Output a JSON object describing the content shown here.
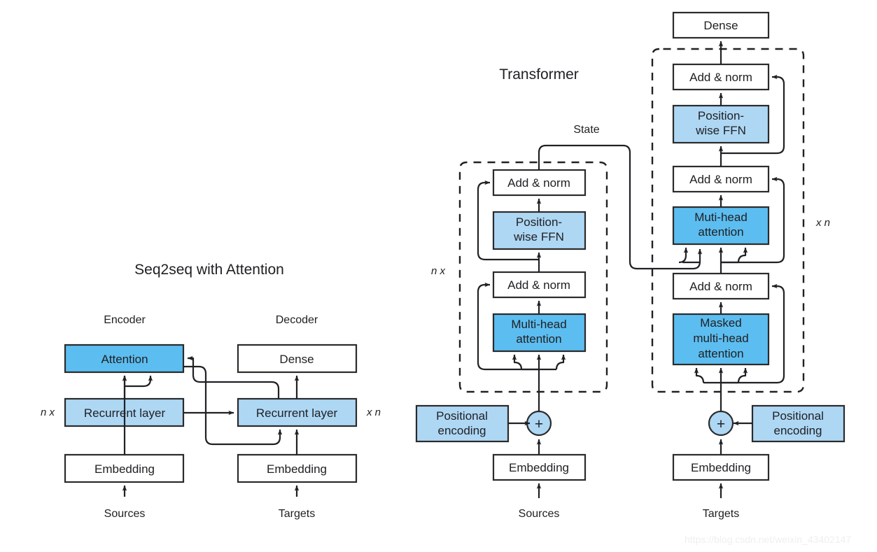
{
  "page": {
    "watermark": "https://blog.csdn.net/weixin_43402147"
  },
  "chart_data": {
    "type": "diagram",
    "title": "Seq2seq with Attention vs Transformer architecture comparison",
    "panels": [
      "Seq2seq with Attention",
      "Transformer"
    ]
  },
  "seq2seq": {
    "title": "Seq2seq with Attention",
    "encoder_label": "Encoder",
    "decoder_label": "Decoder",
    "repeat_left": "n x",
    "repeat_right": "x n",
    "encoder": {
      "attention": "Attention",
      "recurrent": "Recurrent layer",
      "embedding": "Embedding",
      "source": "Sources"
    },
    "decoder": {
      "dense": "Dense",
      "recurrent": "Recurrent layer",
      "embedding": "Embedding",
      "target": "Targets"
    }
  },
  "transformer": {
    "title": "Transformer",
    "state_label": "State",
    "repeat_encoder": "n x",
    "repeat_decoder": "x n",
    "encoder": {
      "add_norm_top": "Add & norm",
      "ffn": "Position-\nwise FFN",
      "ffn_line1": "Position-",
      "ffn_line2": "wise FFN",
      "add_norm_bottom": "Add & norm",
      "attention_line1": "Multi-head",
      "attention_line2": "attention",
      "positional_line1": "Positional",
      "positional_line2": "encoding",
      "plus": "+",
      "embedding": "Embedding",
      "source": "Sources"
    },
    "decoder": {
      "dense": "Dense",
      "add_norm_top": "Add & norm",
      "ffn_line1": "Position-",
      "ffn_line2": "wise FFN",
      "add_norm_mid": "Add & norm",
      "attention_line1": "Muti-head",
      "attention_line2": "attention",
      "add_norm_bottom": "Add & norm",
      "masked_line1": "Masked",
      "masked_line2": "multi-head",
      "masked_line3": "attention",
      "positional_line1": "Positional",
      "positional_line2": "encoding",
      "plus": "+",
      "embedding": "Embedding",
      "target": "Targets"
    }
  },
  "colors": {
    "blue_dark": "#5cbdf0",
    "blue_light": "#aed7f4",
    "stroke": "#2b2b2b",
    "background": "#ffffff"
  }
}
